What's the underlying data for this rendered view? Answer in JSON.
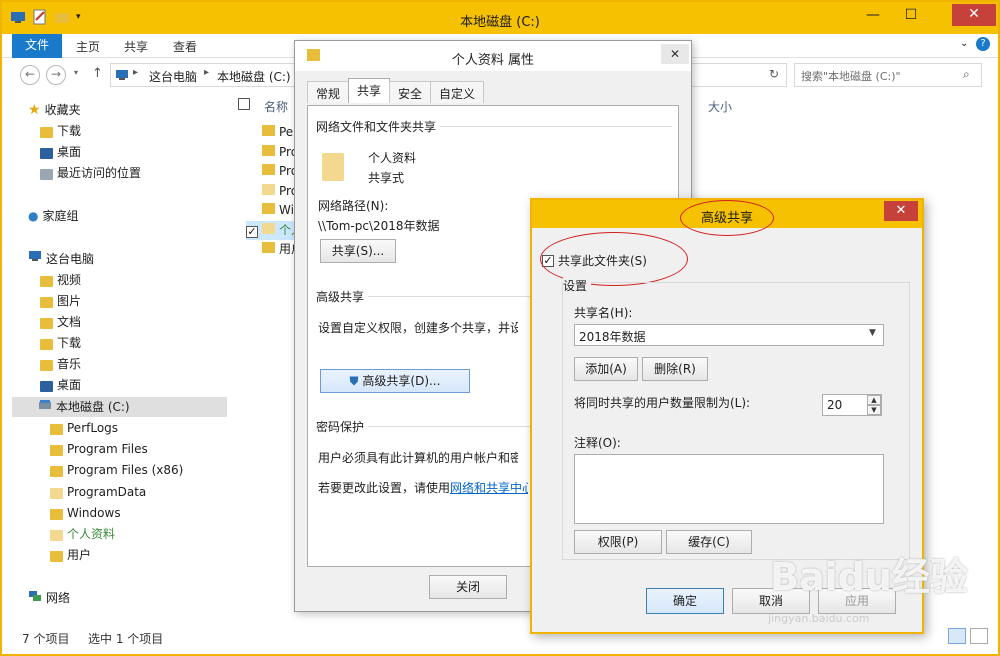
{
  "main_window": {
    "title": "本地磁盘 (C:)",
    "ribbon_tabs": [
      "文件",
      "主页",
      "共享",
      "查看"
    ],
    "breadcrumb": [
      "这台电脑",
      "本地磁盘 (C:)"
    ],
    "search_placeholder": "搜索\"本地磁盘 (C:)\"",
    "column_name": "名称",
    "column_size": "大小",
    "file_list": [
      "Perf",
      "Prog",
      "Prog",
      "Prog",
      "Win",
      "个人",
      "用户"
    ],
    "nav": {
      "favorites": "收藏夹",
      "fav_items": [
        "下载",
        "桌面",
        "最近访问的位置"
      ],
      "homegroup": "家庭组",
      "this_pc": "这台电脑",
      "pc_items": [
        "视频",
        "图片",
        "文档",
        "下载",
        "音乐",
        "桌面"
      ],
      "drive": "本地磁盘 (C:)",
      "drive_items": [
        "PerfLogs",
        "Program Files",
        "Program Files (x86)",
        "ProgramData",
        "Windows",
        "个人资料",
        "用户"
      ],
      "network": "网络"
    },
    "status": {
      "count": "7 个项目",
      "selected": "选中 1 个项目"
    }
  },
  "props_dialog": {
    "title": "个人资料 属性",
    "tabs": [
      "常规",
      "共享",
      "安全",
      "自定义"
    ],
    "share_group_label": "网络文件和文件夹共享",
    "folder_name": "个人资料",
    "folder_state": "共享式",
    "net_path_label": "网络路径(N):",
    "net_path": "\\\\Tom-pc\\2018年数据",
    "share_button": "共享(S)...",
    "adv_group_label": "高级共享",
    "adv_desc": "设置自定义权限，创建多个共享，并设置",
    "adv_button": "高级共享(D)...",
    "pwd_group_label": "密码保护",
    "pwd_desc": "用户必须具有此计算机的用户帐户和密码",
    "pwd_change_prefix": "若要更改此设置，请使用",
    "pwd_link": "网络和共享中心",
    "close_button": "关闭"
  },
  "adv_dialog": {
    "title": "高级共享",
    "share_checkbox": "共享此文件夹(S)",
    "settings_label": "设置",
    "share_name_label": "共享名(H):",
    "share_name_value": "2018年数据",
    "add_button": "添加(A)",
    "remove_button": "删除(R)",
    "limit_label": "将同时共享的用户数量限制为(L):",
    "limit_value": "20",
    "comment_label": "注释(O):",
    "perm_button": "权限(P)",
    "cache_button": "缓存(C)",
    "ok_button": "确定",
    "cancel_button": "取消",
    "apply_button": "应用"
  },
  "watermark": {
    "logo": "Baidu经验",
    "url": "jingyan.baidu.com"
  }
}
